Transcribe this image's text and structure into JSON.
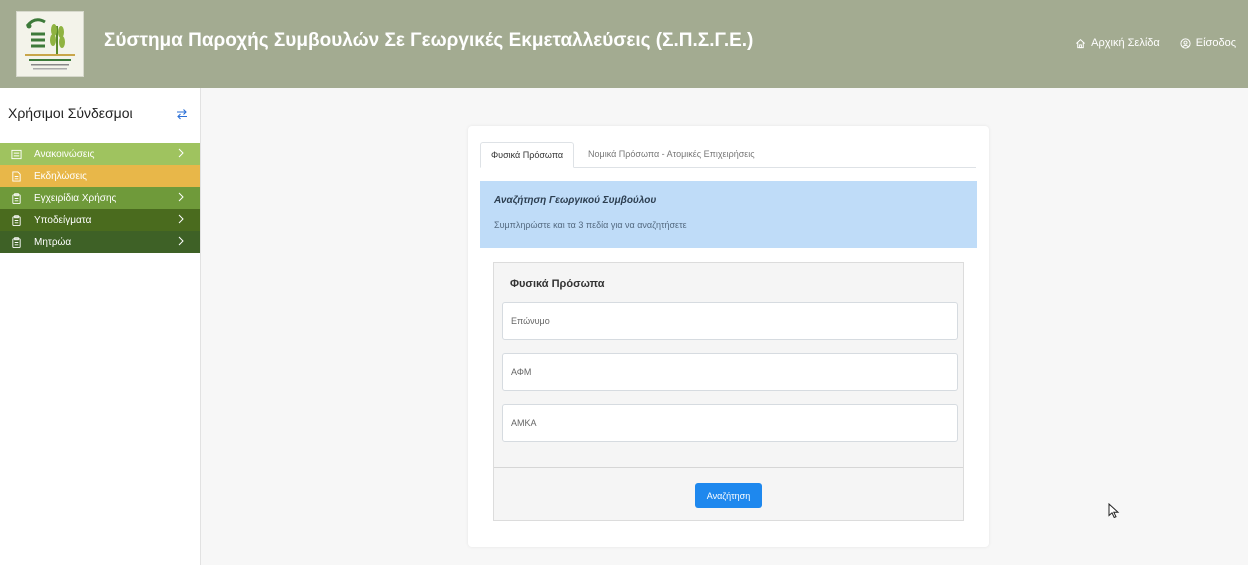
{
  "header": {
    "title": "Σύστημα Παροχής Συμβουλών Σε Γεωργικές Εκμεταλλεύσεις (Σ.Π.Σ.Γ.Ε.)",
    "logo_icon": "elgo-dimitra-logo",
    "nav": [
      {
        "label": "Αρχική Σελίδα",
        "icon": "home-icon"
      },
      {
        "label": "Είσοδος",
        "icon": "user-circle-icon"
      }
    ]
  },
  "sidebar": {
    "title": "Χρήσιμοι Σύνδεσμοι",
    "toggle_icon": "swap-arrows-icon",
    "items": [
      {
        "label": "Ανακοινώσεις",
        "icon": "list-icon",
        "color": "#9fc35f",
        "has_children": true
      },
      {
        "label": "Εκδηλώσεις",
        "icon": "document-icon",
        "color": "#e8b749",
        "has_children": false
      },
      {
        "label": "Εγχειρίδια Χρήσης",
        "icon": "clipboard-icon",
        "color": "#6f9a3a",
        "has_children": true
      },
      {
        "label": "Υποδείγματα",
        "icon": "clipboard-icon",
        "color": "#4a6b1e",
        "has_children": true
      },
      {
        "label": "Μητρώα",
        "icon": "clipboard-icon",
        "color": "#3e6126",
        "has_children": true
      }
    ]
  },
  "tabs": [
    {
      "label": "Φυσικά Πρόσωπα",
      "active": true
    },
    {
      "label": "Νομικά Πρόσωπα - Ατομικές Επιχειρήσεις",
      "active": false
    }
  ],
  "alert": {
    "title": "Αναζήτηση Γεωργικού Συμβούλου",
    "text": "Συμπληρώστε και τα 3 πεδία για να αναζητήσετε"
  },
  "form": {
    "heading": "Φυσικά Πρόσωπα",
    "fields": [
      {
        "placeholder": "Επώνυμο",
        "value": ""
      },
      {
        "placeholder": "ΑΦΜ",
        "value": ""
      },
      {
        "placeholder": "ΑΜΚΑ",
        "value": ""
      }
    ],
    "submit_label": "Αναζήτηση"
  },
  "colors": {
    "header_bg": "#a3ab91",
    "primary_button": "#1e88ee",
    "alert_bg": "#bfdcf8"
  }
}
